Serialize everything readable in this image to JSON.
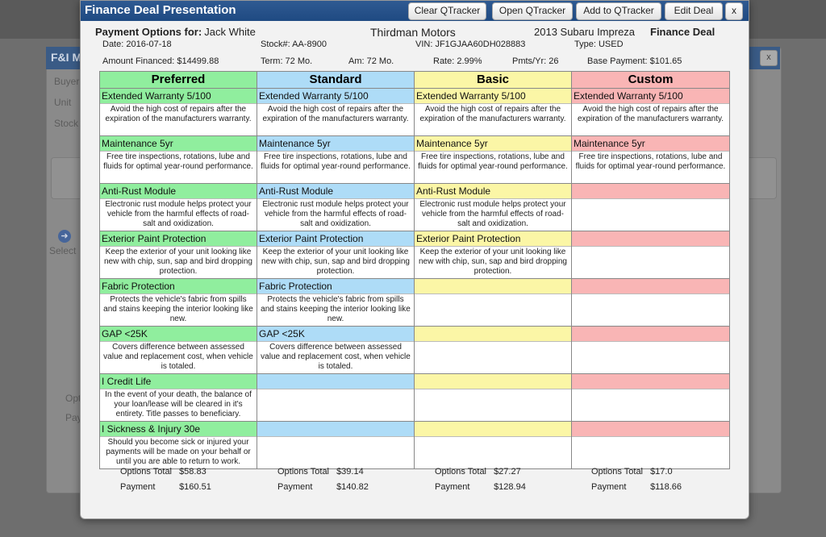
{
  "background": {
    "window_title": "F&I M",
    "labels": [
      "Buyer",
      "Unit",
      "Stock",
      "Select",
      "Opt",
      "Pay"
    ],
    "close_label": "x"
  },
  "modal": {
    "title": "Finance Deal Presentation",
    "buttons": {
      "clear": "Clear QTracker",
      "open": "Open QTracker",
      "add": "Add to QTracker",
      "edit": "Edit Deal",
      "close": "x"
    }
  },
  "header": {
    "payment_label": "Payment Options for:",
    "customer": "Jack White",
    "dealer": "Thirdman Motors",
    "vehicle": "2013 Subaru Impreza",
    "deal_type": "Finance Deal",
    "date": "Date: 2016-07-18",
    "stock": "Stock#: AA-8900",
    "vin": "VIN: JF1GJAA60DH028883",
    "type": "Type: USED",
    "amount_financed": "Amount Financed:  $14499.88",
    "term": "Term: 72 Mo.",
    "am": "Am: 72 Mo.",
    "rate": "Rate: 2.99%",
    "pmts": "Pmts/Yr: 26",
    "base_payment": "Base Payment:  $101.65"
  },
  "colors": {
    "preferred": "#90ee9e",
    "standard": "#aedcf7",
    "basic": "#fbf6a6",
    "custom": "#f9b5b5",
    "titlebar": "#2a558c"
  },
  "columns": [
    {
      "name": "Preferred",
      "items": [
        {
          "name": "Extended Warranty 5/100",
          "desc": "Avoid the high cost of repairs after the expiration of the manufacturers warranty."
        },
        {
          "name": "Maintenance 5yr",
          "desc": "Free tire inspections, rotations, lube and fluids for optimal year-round performance."
        },
        {
          "name": "Anti-Rust Module",
          "desc": "Electronic rust module helps protect your vehicle from the harmful effects of road-salt and oxidization."
        },
        {
          "name": "Exterior Paint Protection",
          "desc": "Keep the exterior of your unit looking like new with chip, sun, sap and bird dropping protection."
        },
        {
          "name": "Fabric Protection",
          "desc": "Protects the vehicle's fabric from spills and stains keeping the interior looking like new."
        },
        {
          "name": "GAP <25K",
          "desc": "Covers difference between assessed value and replacement cost, when vehicle is totaled."
        },
        {
          "name": "I Credit Life",
          "desc": "In the event of your death, the balance of your loan/lease will be cleared in it's entirety. Title passes to beneficiary."
        },
        {
          "name": "I Sickness & Injury 30e",
          "desc": "Should you become sick or injured your payments will be made on your behalf or until you are able to return to work."
        }
      ],
      "options_total": "$58.83",
      "payment": "$160.51"
    },
    {
      "name": "Standard",
      "items": [
        {
          "name": "Extended Warranty 5/100",
          "desc": "Avoid the high cost of repairs after the expiration of the manufacturers warranty."
        },
        {
          "name": "Maintenance 5yr",
          "desc": "Free tire inspections, rotations, lube and fluids for optimal year-round performance."
        },
        {
          "name": "Anti-Rust Module",
          "desc": "Electronic rust module helps protect your vehicle from the harmful effects of road-salt and oxidization."
        },
        {
          "name": "Exterior Paint Protection",
          "desc": "Keep the exterior of your unit looking like new with chip, sun, sap and bird dropping protection."
        },
        {
          "name": "Fabric Protection",
          "desc": "Protects the vehicle's fabric from spills and stains keeping the interior looking like new."
        },
        {
          "name": "GAP <25K",
          "desc": "Covers difference between assessed value and replacement cost, when vehicle is totaled."
        },
        {
          "name": "",
          "desc": ""
        },
        {
          "name": "",
          "desc": ""
        }
      ],
      "options_total": "$39.14",
      "payment": "$140.82"
    },
    {
      "name": "Basic",
      "items": [
        {
          "name": "Extended Warranty 5/100",
          "desc": "Avoid the high cost of repairs after the expiration of the manufacturers warranty."
        },
        {
          "name": "Maintenance 5yr",
          "desc": "Free tire inspections, rotations, lube and fluids for optimal year-round performance."
        },
        {
          "name": "Anti-Rust Module",
          "desc": "Electronic rust module helps protect your vehicle from the harmful effects of road-salt and oxidization."
        },
        {
          "name": "Exterior Paint Protection",
          "desc": "Keep the exterior of your unit looking like new with chip, sun, sap and bird dropping protection."
        },
        {
          "name": "",
          "desc": ""
        },
        {
          "name": "",
          "desc": ""
        },
        {
          "name": "",
          "desc": ""
        },
        {
          "name": "",
          "desc": ""
        }
      ],
      "options_total": "$27.27",
      "payment": "$128.94"
    },
    {
      "name": "Custom",
      "items": [
        {
          "name": "Extended Warranty 5/100",
          "desc": "Avoid the high cost of repairs after the expiration of the manufacturers warranty."
        },
        {
          "name": "Maintenance 5yr",
          "desc": "Free tire inspections, rotations, lube and fluids for optimal year-round performance."
        },
        {
          "name": "",
          "desc": ""
        },
        {
          "name": "",
          "desc": ""
        },
        {
          "name": "",
          "desc": ""
        },
        {
          "name": "",
          "desc": ""
        },
        {
          "name": "",
          "desc": ""
        },
        {
          "name": "",
          "desc": ""
        }
      ],
      "options_total": "$17.0",
      "payment": "$118.66"
    }
  ],
  "totals_labels": {
    "options_total": "Options Total",
    "payment": "Payment"
  }
}
